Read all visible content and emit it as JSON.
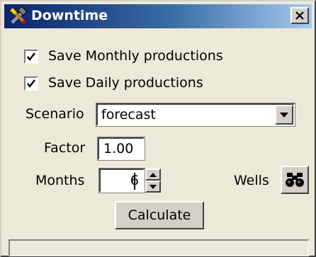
{
  "window": {
    "title": "Downtime",
    "icon": "tools-icon",
    "close_icon": "close-icon"
  },
  "options": {
    "save_monthly": {
      "label": "Save Monthly productions",
      "checked": true
    },
    "save_daily": {
      "label": "Save Daily productions",
      "checked": true
    }
  },
  "scenario": {
    "label": "Scenario",
    "value": "forecast"
  },
  "factor": {
    "label": "Factor",
    "value": "1.00"
  },
  "months": {
    "label": "Months",
    "value": "6"
  },
  "wells": {
    "label": "Wells",
    "icon": "binoculars-icon"
  },
  "calculate": {
    "label": "Calculate"
  },
  "status": {
    "text": ""
  },
  "colors": {
    "titlebar_start": "#0a246a",
    "titlebar_end": "#a6caf0",
    "face": "#ece9d8"
  }
}
